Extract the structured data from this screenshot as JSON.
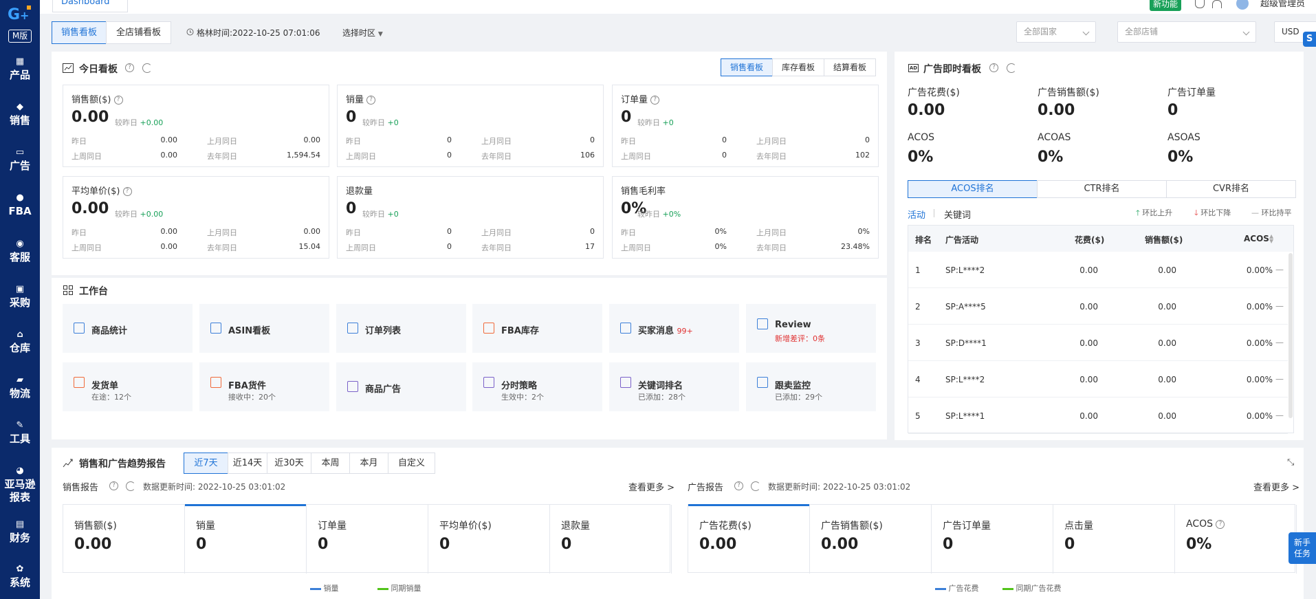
{
  "brand": {
    "version_label": "M版"
  },
  "sidebar": {
    "items": [
      {
        "label": "产品",
        "icon": "grid-icon"
      },
      {
        "label": "销售",
        "icon": "tag-icon"
      },
      {
        "label": "广告",
        "icon": "ad-icon"
      },
      {
        "label": "FBA",
        "icon": "fba-icon"
      },
      {
        "label": "客服",
        "icon": "chat-icon"
      },
      {
        "label": "采购",
        "icon": "clipboard-icon"
      },
      {
        "label": "仓库",
        "icon": "warehouse-icon"
      },
      {
        "label": "物流",
        "icon": "truck-icon"
      },
      {
        "label": "工具",
        "icon": "wrench-icon"
      },
      {
        "label": "亚马逊\n报表",
        "icon": "pie-icon"
      },
      {
        "label": "财务",
        "icon": "finance-icon"
      },
      {
        "label": "系统",
        "icon": "gear-icon"
      }
    ]
  },
  "topbar": {
    "tab": "Dashboard",
    "new_feature": "新功能",
    "user": "超级管理员"
  },
  "toolbar": {
    "board_tabs": [
      "销售看板",
      "全店铺看板"
    ],
    "time_label": "格林时间:2022-10-25 07:01:06",
    "timezone": "选择时区",
    "country": "全部国家",
    "shop": "全部店铺",
    "currency": "USD"
  },
  "today": {
    "title": "今日看板",
    "tabs": [
      "销售看板",
      "库存看板",
      "结算看板"
    ],
    "compare_prefix": "较昨日",
    "row_labels": {
      "yesterday": "昨日",
      "last_week": "上周同日",
      "last_month": "上月同日",
      "last_year": "去年同日"
    },
    "metrics": [
      {
        "label": "销售额($)",
        "value": "0.00",
        "delta": "+0.00",
        "yesterday": "0.00",
        "last_week": "0.00",
        "last_month": "0.00",
        "last_year": "1,594.54",
        "help": true
      },
      {
        "label": "销量",
        "value": "0",
        "delta": "+0",
        "yesterday": "0",
        "last_week": "0",
        "last_month": "0",
        "last_year": "106",
        "help": true
      },
      {
        "label": "订单量",
        "value": "0",
        "delta": "+0",
        "yesterday": "0",
        "last_week": "0",
        "last_month": "0",
        "last_year": "102",
        "help": true
      },
      {
        "label": "平均单价($)",
        "value": "0.00",
        "delta": "+0.00",
        "yesterday": "0.00",
        "last_week": "0.00",
        "last_month": "0.00",
        "last_year": "15.04",
        "help": true
      },
      {
        "label": "退款量",
        "value": "0",
        "delta": "+0",
        "yesterday": "0",
        "last_week": "0",
        "last_month": "0",
        "last_year": "17",
        "help": false
      },
      {
        "label": "销售毛利率",
        "value": "0%",
        "delta": "+0%",
        "yesterday": "0%",
        "last_week": "0%",
        "last_month": "0%",
        "last_year": "23.48%",
        "help": false
      }
    ]
  },
  "ads_live": {
    "title": "广告即时看板",
    "metrics": [
      {
        "label": "广告花费($)",
        "value": "0.00"
      },
      {
        "label": "广告销售额($)",
        "value": "0.00"
      },
      {
        "label": "广告订单量",
        "value": "0"
      },
      {
        "label": "ACOS",
        "value": "0%"
      },
      {
        "label": "ACOAS",
        "value": "0%"
      },
      {
        "label": "ASOAS",
        "value": "0%"
      }
    ],
    "rank_tabs": [
      "ACOS排名",
      "CTR排名",
      "CVR排名"
    ],
    "sub_tabs": [
      "活动",
      "关键词"
    ],
    "legend": [
      "环比上升",
      "环比下降",
      "环比持平"
    ],
    "columns": [
      "排名",
      "广告活动",
      "花费($)",
      "销售额($)",
      "ACOS"
    ],
    "rows": [
      {
        "rank": "1",
        "campaign": "SP:L****2",
        "spend": "0.00",
        "sales": "0.00",
        "acos": "0.00%"
      },
      {
        "rank": "2",
        "campaign": "SP:A****5",
        "spend": "0.00",
        "sales": "0.00",
        "acos": "0.00%"
      },
      {
        "rank": "3",
        "campaign": "SP:D****1",
        "spend": "0.00",
        "sales": "0.00",
        "acos": "0.00%"
      },
      {
        "rank": "4",
        "campaign": "SP:L****2",
        "spend": "0.00",
        "sales": "0.00",
        "acos": "0.00%"
      },
      {
        "rank": "5",
        "campaign": "SP:L****1",
        "spend": "0.00",
        "sales": "0.00",
        "acos": "0.00%"
      }
    ]
  },
  "workbench": {
    "title": "工作台",
    "tiles": [
      {
        "title": "商品统计",
        "sub": "",
        "badge": ""
      },
      {
        "title": "ASIN看板",
        "sub": "",
        "badge": ""
      },
      {
        "title": "订单列表",
        "sub": "",
        "badge": ""
      },
      {
        "title": "FBA库存",
        "sub": "",
        "badge": ""
      },
      {
        "title": "买家消息",
        "sub": "",
        "badge": "99+"
      },
      {
        "title": "Review",
        "sub": "新增差评：0条",
        "badge": ""
      },
      {
        "title": "发货单",
        "sub": "在途：12个",
        "badge": ""
      },
      {
        "title": "FBA货件",
        "sub": "接收中：20个",
        "badge": ""
      },
      {
        "title": "商品广告",
        "sub": "",
        "badge": ""
      },
      {
        "title": "分时策略",
        "sub": "生效中：2个",
        "badge": ""
      },
      {
        "title": "关键词排名",
        "sub": "已添加：28个",
        "badge": ""
      },
      {
        "title": "跟卖监控",
        "sub": "已添加：29个",
        "badge": ""
      }
    ]
  },
  "trend": {
    "title": "销售和广告趋势报告",
    "ranges": [
      "近7天",
      "近14天",
      "近30天",
      "本周",
      "本月",
      "自定义"
    ],
    "sales": {
      "title": "销售报告",
      "updated": "数据更新时间: 2022-10-25 03:01:02",
      "more": "查看更多 >",
      "cells": [
        {
          "label": "销售额($)",
          "value": "0.00"
        },
        {
          "label": "销量",
          "value": "0"
        },
        {
          "label": "订单量",
          "value": "0"
        },
        {
          "label": "平均单价($)",
          "value": "0"
        },
        {
          "label": "退款量",
          "value": "0"
        }
      ],
      "legend": [
        "销量",
        "同期销量"
      ]
    },
    "ads": {
      "title": "广告报告",
      "updated": "数据更新时间: 2022-10-25 03:01:02",
      "more": "查看更多 >",
      "cells": [
        {
          "label": "广告花费($)",
          "value": "0.00"
        },
        {
          "label": "广告销售额($)",
          "value": "0.00"
        },
        {
          "label": "广告订单量",
          "value": "0"
        },
        {
          "label": "点击量",
          "value": "0"
        },
        {
          "label": "ACOS",
          "value": "0%"
        }
      ],
      "legend": [
        "广告花费",
        "同期广告花费"
      ]
    }
  },
  "newbie": "新手\n任务",
  "colors": {
    "primary": "#1f73d6",
    "sidebar": "#0b2a6b",
    "up": "#18a058",
    "down": "#e03131"
  }
}
